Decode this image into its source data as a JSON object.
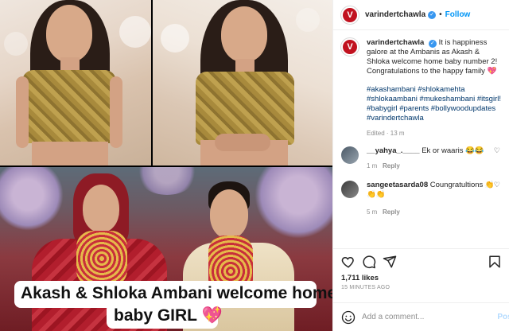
{
  "header": {
    "username": "varindertchawla",
    "verified_icon": "verified-badge-icon",
    "separator": "•",
    "follow_label": "Follow"
  },
  "caption": {
    "username": "varindertchawla",
    "text": "It is happiness galore at the Ambanis as Akash & Shloka welcome home baby number 2! Congratulations to the happy family 💖",
    "hashtags": "#akashambani #shlokamehta #shlokaambani #mukeshambani #itsgirl! #babygirl #parents #bollywoodupdates #varindertchawla",
    "edited": "Edited · 13 m"
  },
  "comments": [
    {
      "username": "__yahya_.____",
      "text": "Ek or waaris 😂😂",
      "time": "1 m",
      "reply_label": "Reply"
    },
    {
      "username": "sangeetasarda08",
      "text": "Coungratultions 👏👏👏",
      "time": "5 m",
      "reply_label": "Reply"
    }
  ],
  "stats": {
    "likes": "1,711 likes",
    "timestamp": "15 MINUTES AGO"
  },
  "comment_box": {
    "placeholder": "Add a comment...",
    "post_label": "Post"
  },
  "image_overlay": {
    "line1": "Akash & Shloka Ambani welcome home a",
    "line2": "baby GIRL",
    "emoji": "💖"
  },
  "colors": {
    "brand_red": "#c1121f",
    "link_blue": "#0095f6",
    "hashtag_blue": "#00376b"
  }
}
